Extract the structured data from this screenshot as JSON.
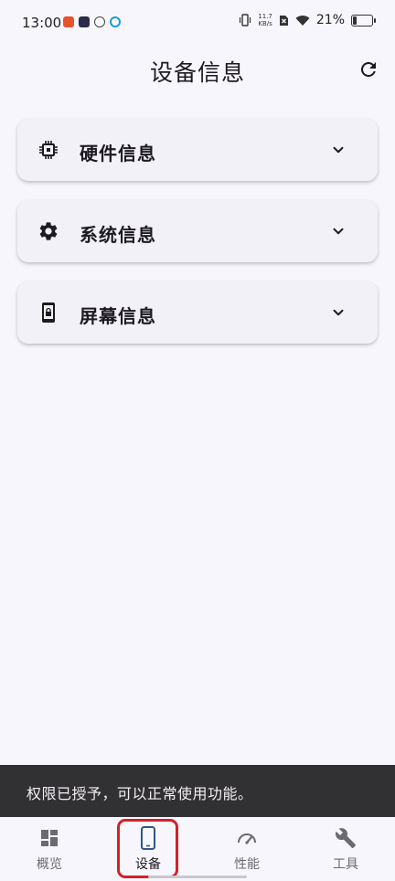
{
  "status_bar": {
    "time": "13:00",
    "net_speed_value": "11.7",
    "net_speed_unit": "KB/s",
    "battery": "21%"
  },
  "header": {
    "title": "设备信息"
  },
  "cards": [
    {
      "label": "硬件信息",
      "icon": "chip-icon"
    },
    {
      "label": "系统信息",
      "icon": "gear-icon"
    },
    {
      "label": "屏幕信息",
      "icon": "phone-lock-icon"
    }
  ],
  "snackbar": {
    "message": "权限已授予，可以正常使用功能。"
  },
  "bottom_nav": {
    "items": [
      {
        "label": "概览",
        "icon": "dashboard-icon",
        "active": false
      },
      {
        "label": "设备",
        "icon": "phone-icon",
        "active": true
      },
      {
        "label": "性能",
        "icon": "speedometer-icon",
        "active": false
      },
      {
        "label": "工具",
        "icon": "wrench-icon",
        "active": false
      }
    ]
  },
  "colors": {
    "background": "#f7f6fc",
    "card": "#f2f1f7",
    "snackbar": "#313033",
    "active_accent": "#2c5a8a",
    "highlight": "#d4202b"
  }
}
